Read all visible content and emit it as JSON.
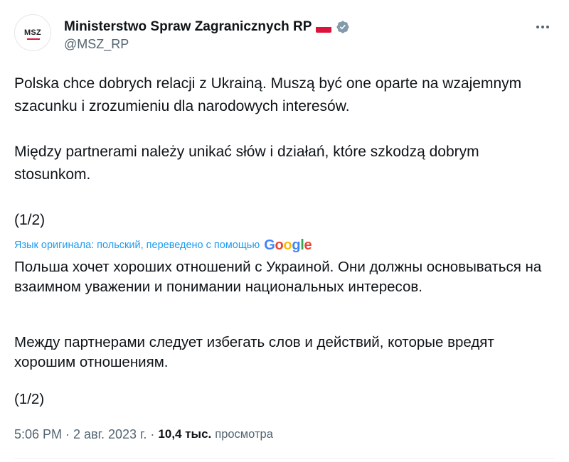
{
  "author": {
    "avatar_text": "MSZ",
    "display_name": "Ministerstwo Spraw Zagranicznych RP",
    "handle": "@MSZ_RP",
    "flag_icon": "poland-flag-icon",
    "verified_icon": "verified-badge-icon",
    "verified_color": "#829aab"
  },
  "more_icon": "more-horizontal-icon",
  "tweet": {
    "paragraph_1": "Polska chce dobrych relacji z Ukrainą. Muszą być one oparte na wzajemnym szacunku i zrozumieniu dla narodowych interesów.",
    "paragraph_2": "Między partnerami należy unikać słów i działań, które szkodzą dobrym stosunkom.",
    "paragraph_3": "(1/2)"
  },
  "translation": {
    "notice": "Язык оригинала: польский, переведено с помощью",
    "provider": "Google",
    "link_color": "#1d9bf0",
    "paragraph_1": "Польша хочет хороших отношений с Украиной. Они должны основываться на взаимном уважении и понимании национальных интересов.",
    "paragraph_2": "Между партнерами следует избегать слов и действий, которые вредят хорошим отношениям.",
    "paragraph_3": "(1/2)"
  },
  "meta": {
    "time": "5:06 PM",
    "separator": "·",
    "date": "2 авг. 2023 г.",
    "views_count": "10,4 тыс.",
    "views_label": "просмотра"
  }
}
